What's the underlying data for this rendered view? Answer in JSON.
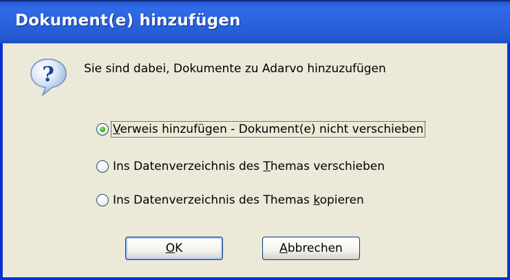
{
  "window": {
    "title": "Dokument(e) hinzufügen"
  },
  "message": "Sie sind dabei, Dokumente zu Adarvo hinzuzufügen",
  "options": [
    {
      "pre": "",
      "mnemonic": "V",
      "post": "erweis hinzufügen - Dokument(e) nicht verschieben",
      "checked": true
    },
    {
      "pre": "Ins Datenverzeichnis des ",
      "mnemonic": "T",
      "post": "hemas verschieben",
      "checked": false
    },
    {
      "pre": "Ins Datenverzeichnis des Themas ",
      "mnemonic": "k",
      "post": "opieren",
      "checked": false
    }
  ],
  "buttons": {
    "ok": {
      "mnemonic": "O",
      "rest": "K"
    },
    "cancel": {
      "mnemonic": "A",
      "rest": "bbrechen"
    }
  },
  "icons": {
    "dialog_icon": "question-icon"
  },
  "colors": {
    "titlebar": "#2B63DD",
    "frame": "#0831D9",
    "dialog_bg": "#ECE9D8",
    "radio_check": "#2FB31F"
  }
}
